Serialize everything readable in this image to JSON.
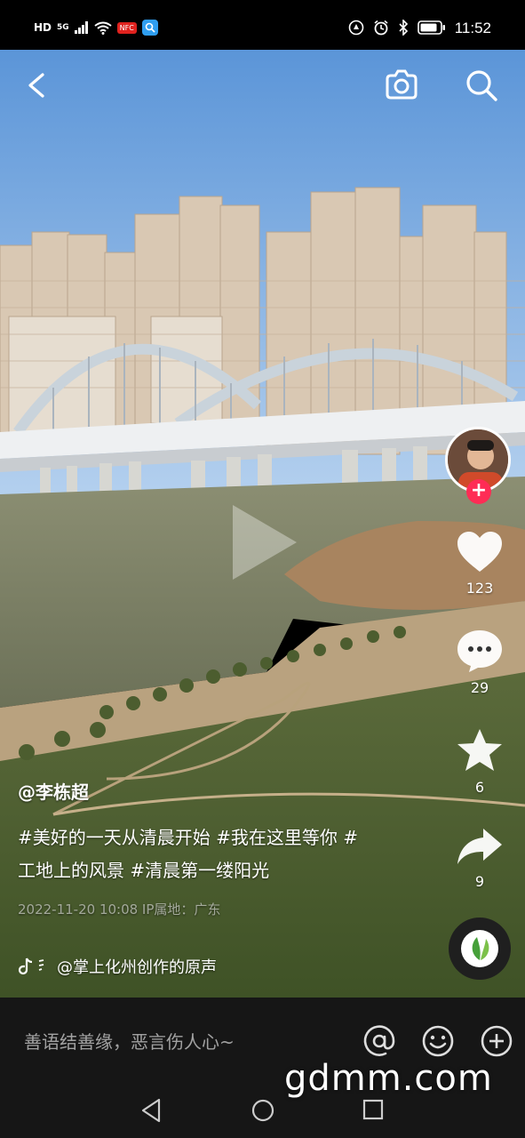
{
  "status_bar": {
    "hd": "HD",
    "network": "5G",
    "time": "11:52",
    "badge_red": "NFC"
  },
  "top_bar": {
    "back_icon": "back-icon",
    "camera_icon": "camera-icon",
    "search_icon": "search-icon"
  },
  "right_rail": {
    "likes": "123",
    "comments": "29",
    "favorites": "6",
    "shares": "9",
    "follow_label": "+"
  },
  "caption": {
    "author": "@李栋超",
    "description": "#美好的一天从清晨开始 #我在这里等你 #工地上的风景 #清晨第一缕阳光",
    "meta": "2022-11-20 10:08 IP属地：广东",
    "music": "@掌上化州创作的原声"
  },
  "comment_bar": {
    "placeholder": "善语结善缘，恶言伤人心~"
  },
  "watermark": "gdmm.com",
  "colors": {
    "sky_top": "#5b95d8",
    "sky_bottom": "#b7d2ef",
    "accent": "#fe2c55",
    "bar_bg": "#161616"
  }
}
